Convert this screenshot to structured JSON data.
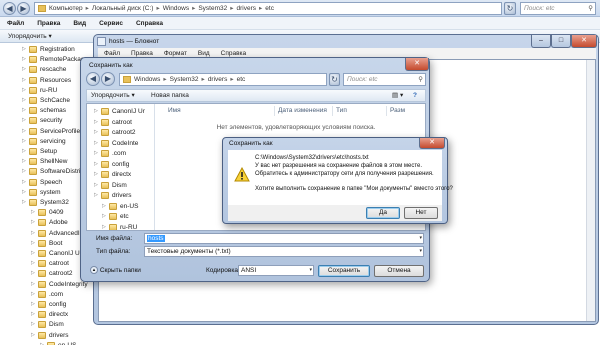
{
  "explorer": {
    "address_parts": [
      "Компьютер",
      "Локальный диск (C:)",
      "Windows",
      "System32",
      "drivers",
      "etc"
    ],
    "search_placeholder": "Поиск: etc",
    "menu": [
      "Файл",
      "Правка",
      "Вид",
      "Сервис",
      "Справка"
    ],
    "toolbar_organize": "Упорядочить",
    "tree": [
      {
        "label": "Registration",
        "indent": 0
      },
      {
        "label": "RemotePackages",
        "indent": 0
      },
      {
        "label": "rescache",
        "indent": 0
      },
      {
        "label": "Resources",
        "indent": 0
      },
      {
        "label": "ru-RU",
        "indent": 0
      },
      {
        "label": "SchCache",
        "indent": 0
      },
      {
        "label": "schemas",
        "indent": 0
      },
      {
        "label": "security",
        "indent": 0
      },
      {
        "label": "ServiceProfiles",
        "indent": 0
      },
      {
        "label": "servicing",
        "indent": 0
      },
      {
        "label": "Setup",
        "indent": 0
      },
      {
        "label": "ShellNew",
        "indent": 0
      },
      {
        "label": "SoftwareDistribution",
        "indent": 0
      },
      {
        "label": "Speech",
        "indent": 0
      },
      {
        "label": "system",
        "indent": 0
      },
      {
        "label": "System32",
        "indent": 0
      },
      {
        "label": "0409",
        "indent": 1
      },
      {
        "label": "Adobe",
        "indent": 1
      },
      {
        "label": "AdvancedInstallers",
        "indent": 1
      },
      {
        "label": "Boot",
        "indent": 1
      },
      {
        "label": "CanonIJ Uninstaller",
        "indent": 1
      },
      {
        "label": "catroot",
        "indent": 1
      },
      {
        "label": "catroot2",
        "indent": 1
      },
      {
        "label": "CodeIntegrity",
        "indent": 1
      },
      {
        "label": ".com",
        "indent": 1
      },
      {
        "label": "config",
        "indent": 1
      },
      {
        "label": "directx",
        "indent": 1
      },
      {
        "label": "Dism",
        "indent": 1
      },
      {
        "label": "drivers",
        "indent": 1
      },
      {
        "label": "en-US",
        "indent": 2
      }
    ]
  },
  "notepad": {
    "title": "hosts — Блокнот",
    "menu": [
      "Файл",
      "Правка",
      "Формат",
      "Вид",
      "Справка"
    ]
  },
  "saveas": {
    "title": "Сохранить как",
    "address_parts": [
      "Windows",
      "System32",
      "drivers",
      "etc"
    ],
    "search_placeholder": "Поиск: etc",
    "organize": "Упорядочить",
    "new_folder": "Новая папка",
    "tree": [
      {
        "label": "CanonIJ Ur",
        "indent": 0
      },
      {
        "label": "catroot",
        "indent": 0
      },
      {
        "label": "catroot2",
        "indent": 0
      },
      {
        "label": "CodeInte",
        "indent": 0
      },
      {
        "label": ".com",
        "indent": 0
      },
      {
        "label": "config",
        "indent": 0
      },
      {
        "label": "directx",
        "indent": 0
      },
      {
        "label": "Dism",
        "indent": 0
      },
      {
        "label": "drivers",
        "indent": 0
      },
      {
        "label": "en-US",
        "indent": 1
      },
      {
        "label": "etc",
        "indent": 1
      },
      {
        "label": "ru-RU",
        "indent": 1
      },
      {
        "label": "UMDF",
        "indent": 1
      }
    ],
    "columns": [
      "Имя",
      "Дата изменения",
      "Тип",
      "Разм"
    ],
    "empty_text": "Нет элементов, удовлетворяющих условиям поиска.",
    "filename_label": "Имя файла:",
    "filename_value": "hosts",
    "filetype_label": "Тип файла:",
    "filetype_value": "Текстовые документы (*.txt)",
    "hide_folders": "Скрыть папки",
    "encoding_label": "Кодировка:",
    "encoding_value": "ANSI",
    "save_button": "Сохранить",
    "cancel_button": "Отмена"
  },
  "alert": {
    "title": "Сохранить как",
    "path": "C:\\Windows\\System32\\drivers\\etc\\hosts.txt",
    "message_line1": "У вас нет разрешения на сохранение файлов в этом месте.",
    "message_line2": "Обратитесь к администратору сети для получения разрешения.",
    "question": "Хотите выполнить сохранение в папке \"Мои документы\" вместо этого?",
    "yes_button": "Да",
    "no_button": "Нет"
  }
}
